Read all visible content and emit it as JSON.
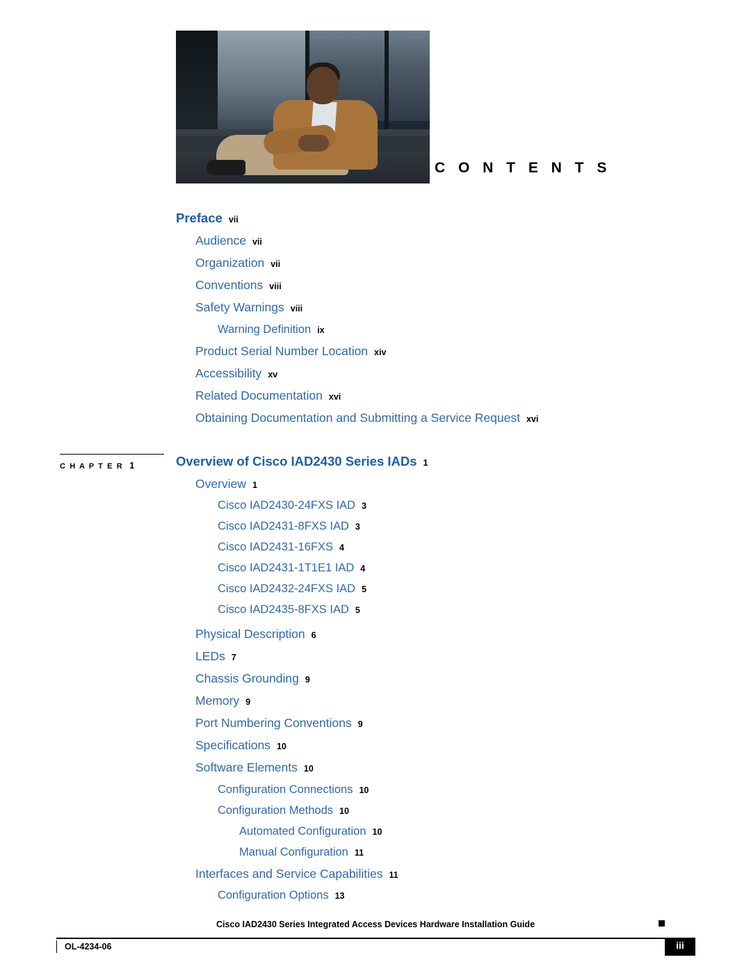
{
  "page": {
    "title": "C O N T E N T S",
    "hero_image": "photo-man-seated-airport"
  },
  "toc": {
    "entries": [
      {
        "label": "Preface",
        "page": "vii",
        "level": 0
      },
      {
        "label": "Audience",
        "page": "vii",
        "level": 1
      },
      {
        "label": "Organization",
        "page": "vii",
        "level": 1
      },
      {
        "label": "Conventions",
        "page": "viii",
        "level": 1
      },
      {
        "label": "Safety Warnings",
        "page": "viii",
        "level": 1
      },
      {
        "label": "Warning Definition",
        "page": "ix",
        "level": 2
      },
      {
        "label": "Product Serial Number Location",
        "page": "xiv",
        "level": 1
      },
      {
        "label": "Accessibility",
        "page": "xv",
        "level": 1
      },
      {
        "label": "Related Documentation",
        "page": "xvi",
        "level": 1
      },
      {
        "label": "Obtaining Documentation and Submitting a Service Request",
        "page": "xvi",
        "level": 1
      },
      {
        "label": "Overview of Cisco IAD2430 Series IADs",
        "page": "1",
        "level": 0
      },
      {
        "label": "Overview",
        "page": "1",
        "level": 1
      },
      {
        "label": "Cisco IAD2430-24FXS IAD",
        "page": "3",
        "level": 2
      },
      {
        "label": "Cisco IAD2431-8FXS IAD",
        "page": "3",
        "level": 2
      },
      {
        "label": "Cisco IAD2431-16FXS",
        "page": "4",
        "level": 2
      },
      {
        "label": "Cisco IAD2431-1T1E1 IAD",
        "page": "4",
        "level": 2
      },
      {
        "label": "Cisco IAD2432-24FXS IAD",
        "page": "5",
        "level": 2
      },
      {
        "label": "Cisco IAD2435-8FXS IAD",
        "page": "5",
        "level": 2
      },
      {
        "label": "Physical Description",
        "page": "6",
        "level": 1
      },
      {
        "label": "LEDs",
        "page": "7",
        "level": 1
      },
      {
        "label": "Chassis Grounding",
        "page": "9",
        "level": 1
      },
      {
        "label": "Memory",
        "page": "9",
        "level": 1
      },
      {
        "label": "Port Numbering Conventions",
        "page": "9",
        "level": 1
      },
      {
        "label": "Specifications",
        "page": "10",
        "level": 1
      },
      {
        "label": "Software Elements",
        "page": "10",
        "level": 1
      },
      {
        "label": "Configuration Connections",
        "page": "10",
        "level": 2
      },
      {
        "label": "Configuration Methods",
        "page": "10",
        "level": 2
      },
      {
        "label": "Automated Configuration",
        "page": "10",
        "level": 3
      },
      {
        "label": "Manual Configuration",
        "page": "11",
        "level": 3
      },
      {
        "label": "Interfaces and Service Capabilities",
        "page": "11",
        "level": 1
      },
      {
        "label": "Configuration Options",
        "page": "13",
        "level": 2
      }
    ]
  },
  "chapter_marker": {
    "label": "C H A P T E R",
    "number": "1"
  },
  "footer": {
    "book_title": "Cisco IAD2430 Series Integrated Access Devices Hardware Installation Guide",
    "doc_id": "OL-4234-06",
    "page_number": "iii"
  },
  "colors": {
    "link_blue": "#2e68b0",
    "heading_blue": "#1b5faa",
    "text_black": "#000000"
  }
}
